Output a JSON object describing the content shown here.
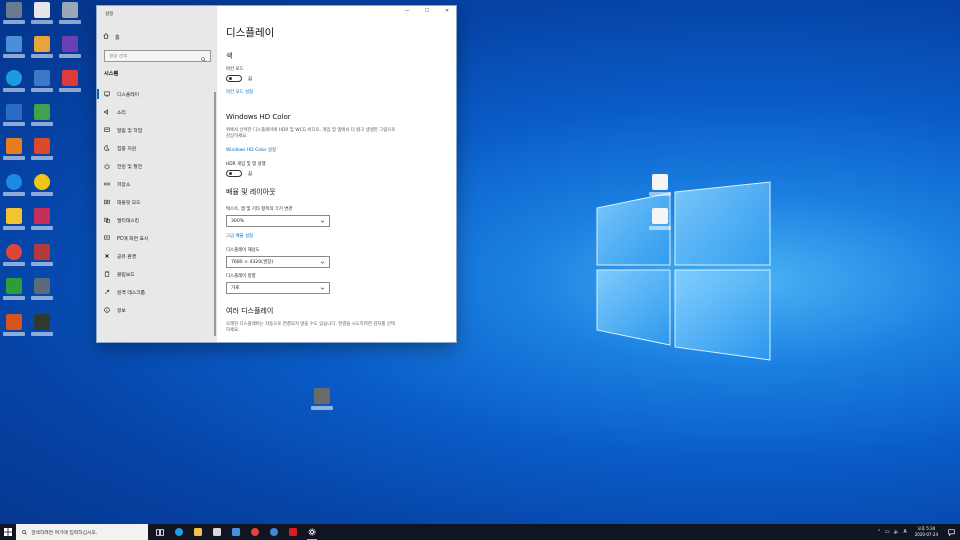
{
  "colors": {
    "accent": "#0067c0",
    "nav_bg": "#e8e8e8",
    "taskbar": "#101521"
  },
  "window": {
    "title": "설정",
    "caption_minimize": "—",
    "caption_maximize": "☐",
    "caption_close": "✕"
  },
  "nav": {
    "home_label": "홈",
    "search_placeholder": "설정 검색",
    "section_title": "시스템",
    "items": [
      {
        "label": "디스플레이",
        "icon": "monitor-icon",
        "active": true
      },
      {
        "label": "소리",
        "icon": "speaker-icon"
      },
      {
        "label": "알림 및 작업",
        "icon": "notification-icon"
      },
      {
        "label": "집중 지원",
        "icon": "moon-icon"
      },
      {
        "label": "전원 및 절전",
        "icon": "power-icon"
      },
      {
        "label": "저장소",
        "icon": "storage-icon"
      },
      {
        "label": "태블릿 모드",
        "icon": "tablet-icon"
      },
      {
        "label": "멀티태스킹",
        "icon": "multitasking-icon"
      },
      {
        "label": "PC에 화면 표시",
        "icon": "project-icon"
      },
      {
        "label": "공유 환경",
        "icon": "shared-experiences-icon"
      },
      {
        "label": "클립보드",
        "icon": "clipboard-icon"
      },
      {
        "label": "원격 데스크톱",
        "icon": "remote-desktop-icon"
      },
      {
        "label": "정보",
        "icon": "info-icon"
      }
    ]
  },
  "content": {
    "page_title": "디스플레이",
    "color_heading": "색",
    "night_light_label": "야간 모드",
    "night_light_state": "끔",
    "night_light_link": "야간 모드 설정",
    "hdr_heading": "Windows HD Color",
    "hdr_desc": "위에서 선택한 디스플레이에 HDR 및 WCG 비디오, 게임 및 앱에서 더 밝고 생생한 그림으로 감상하세요.",
    "hdr_link": "Windows HD Color 설정",
    "hdr_toggle_label": "HDR 게임 및 앱 실행",
    "hdr_toggle_state": "끔",
    "layout_heading": "배율 및 레이아웃",
    "scale_label": "텍스트, 앱 및 기타 항목의 크기 변경",
    "scale_value": "300%",
    "advanced_scale_link": "고급 배율 설정",
    "resolution_label": "디스플레이 해상도",
    "resolution_value": "7680 × 4320(권장)",
    "orientation_label": "디스플레이 방향",
    "orientation_value": "가로",
    "multi_heading": "여러 디스플레이",
    "multi_desc": "오래된 디스플레이는 자동으로 연결되지 않을 수도 있습니다. 연결을 시도하려면 감지를 선택하세요."
  },
  "taskbar": {
    "search_placeholder": "검색하려면 여기에 입력하십시오.",
    "tray_lang": "A",
    "clock_time": "오후 5:34",
    "clock_date": "2020-07-24"
  }
}
